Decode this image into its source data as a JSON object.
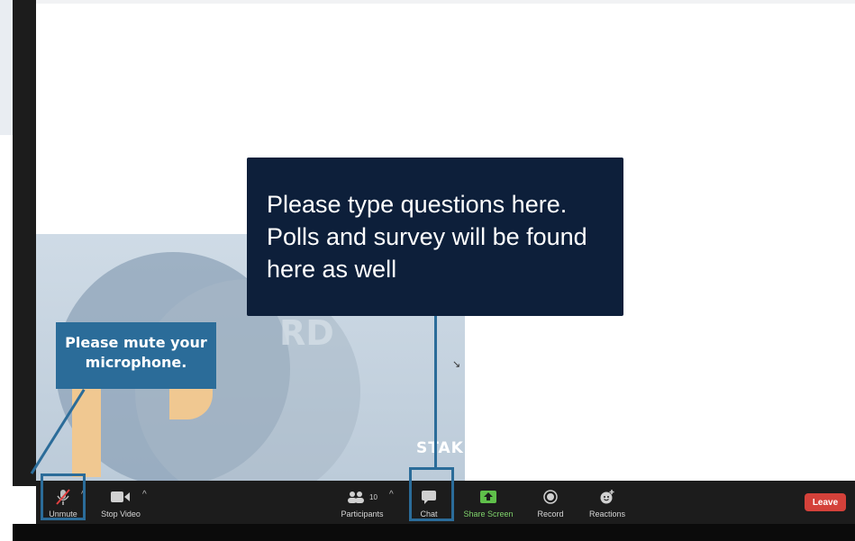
{
  "callouts": {
    "chat_tip": "Please type questions here. Polls and survey will be found here as well",
    "mute_tip": "Please mute your microphone."
  },
  "shared_content": {
    "text_fragment": "STAKE",
    "faint_text": "RD"
  },
  "toolbar": {
    "unmute_label": "Unmute",
    "stop_video_label": "Stop Video",
    "participants_label": "Participants",
    "participants_count": "10",
    "chat_label": "Chat",
    "share_screen_label": "Share Screen",
    "record_label": "Record",
    "reactions_label": "Reactions",
    "leave_label": "Leave"
  },
  "colors": {
    "callout_dark": "#0d1f3a",
    "callout_blue": "#2b6c99",
    "leave_red": "#d4413a",
    "share_green": "#7fd36b"
  }
}
